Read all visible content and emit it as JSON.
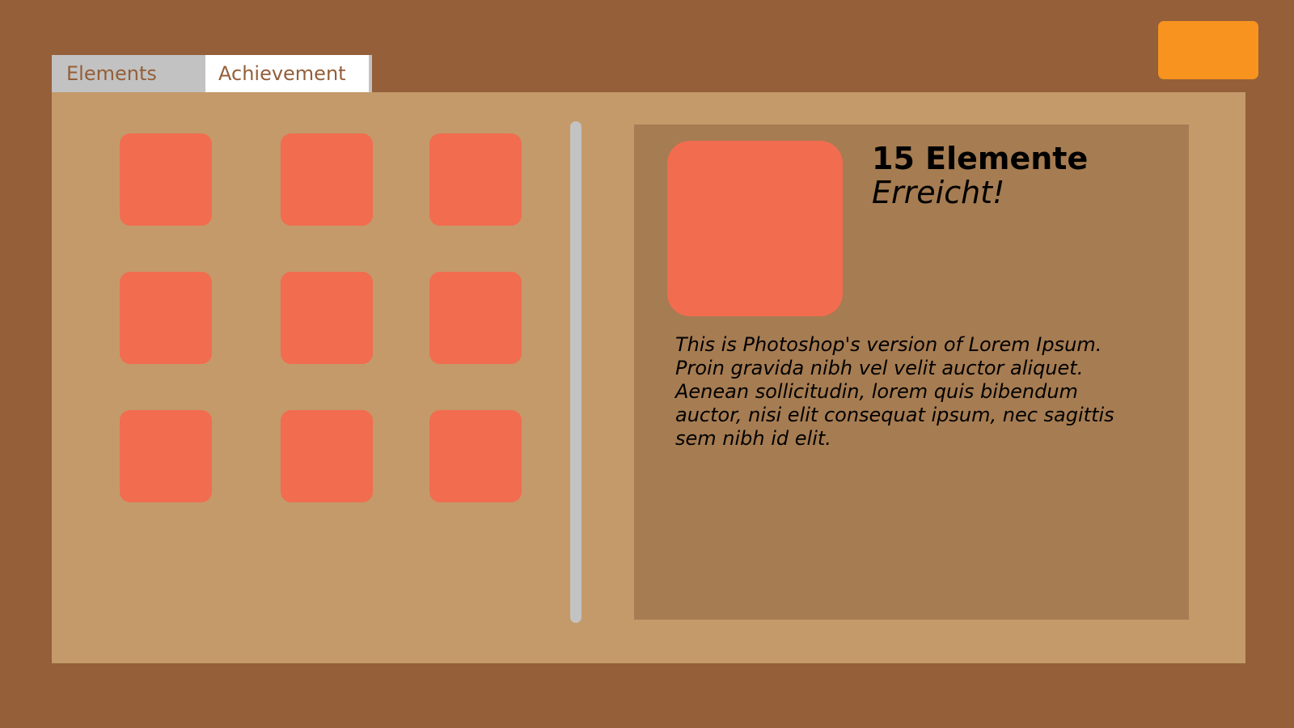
{
  "tabs": {
    "elements_label": "Elements",
    "achievement_label": "Achievement",
    "active": "Achievement"
  },
  "element_grid": {
    "count": 9
  },
  "achievement_detail": {
    "title": "15 Elemente",
    "subtitle": "Erreicht!",
    "description": "This is Photoshop's version  of Lorem Ipsum. Proin gravida nibh vel velit auctor aliquet. Aenean sollicitudin, lorem quis bibendum auctor, nisi elit consequat ipsum, nec sagittis sem nibh id elit."
  },
  "colors": {
    "background": "#945f39",
    "panel": "#c49a6a",
    "detail_panel": "#a67c52",
    "tile": "#f26c4f",
    "accent_button": "#f7931e",
    "tab_inactive": "#c2c2c2",
    "tab_active": "#ffffff",
    "scrollbar": "#c3c3c3"
  },
  "icons": {
    "element_tile": "rounded-square-tile",
    "achievement_badge": "rounded-square-badge"
  }
}
